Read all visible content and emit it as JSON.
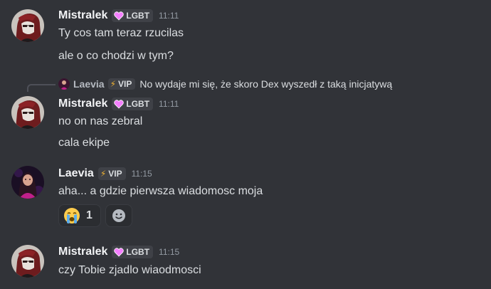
{
  "colors": {
    "background": "#313338",
    "username": "#f2f3f5",
    "timestamp": "#949ba4",
    "tag_bg": "#3f4147",
    "bolt": "#f0b232",
    "heart": "#f47fff"
  },
  "messages": [
    {
      "author": "Mistralek",
      "tag_icon": "heart-icon",
      "tag": "LGBT",
      "time": "11:11",
      "lines": [
        "Ty cos tam teraz rzucilas",
        "ale o co chodzi w tym?"
      ]
    },
    {
      "reply": {
        "author": "Laevia",
        "tag_icon": "bolt-icon",
        "tag": "VIP",
        "text": "No wydaje mi się, że skoro Dex wyszedł z taką inicjatywą"
      },
      "author": "Mistralek",
      "tag_icon": "heart-icon",
      "tag": "LGBT",
      "time": "11:11",
      "lines": [
        "no on nas zebral",
        "cala ekipe"
      ]
    },
    {
      "author": "Laevia",
      "tag_icon": "bolt-icon",
      "tag": "VIP",
      "time": "11:15",
      "lines": [
        "aha... a gdzie pierwsza wiadomosc moja"
      ],
      "reactions": [
        {
          "emoji": "crying-face-emoji",
          "count": "1"
        },
        {
          "emoji": "add-reaction-icon"
        }
      ]
    },
    {
      "author": "Mistralek",
      "tag_icon": "heart-icon",
      "tag": "LGBT",
      "time": "11:15",
      "lines": [
        "czy Tobie zjadlo wiaodmosci"
      ]
    }
  ]
}
